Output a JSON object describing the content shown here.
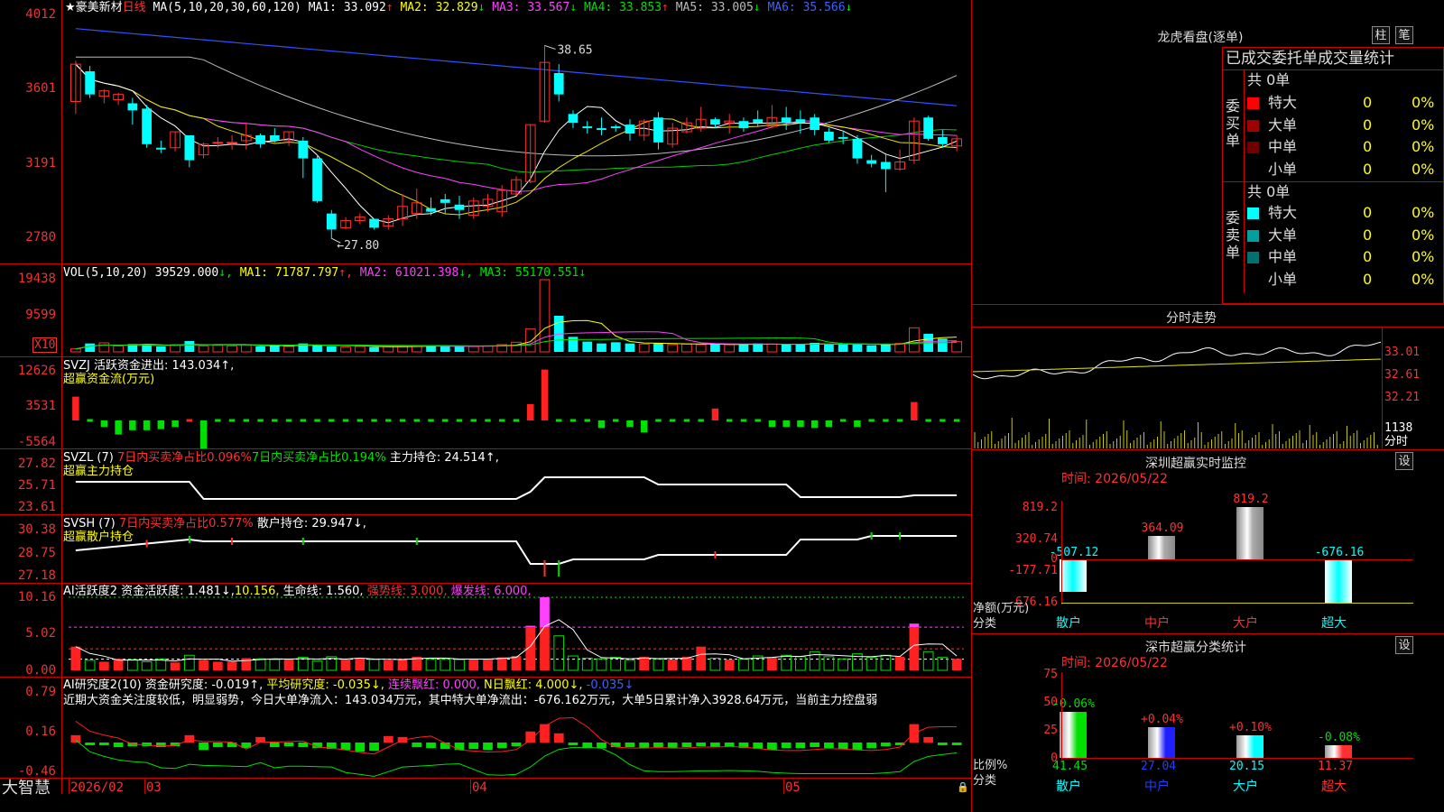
{
  "kline": {
    "header_name": "★豪美新材",
    "header_period": "日线",
    "ma_label": "MA(5,10,20,30,60,120)",
    "ma_items": [
      {
        "text": "MA1: 33.092",
        "arrow": "↑",
        "color": "#ffffff"
      },
      {
        "text": "MA2: 32.829",
        "arrow": "↓",
        "color": "#ffff00"
      },
      {
        "text": "MA3: 33.567",
        "arrow": "↓",
        "color": "#ff40ff"
      },
      {
        "text": "MA4: 33.853",
        "arrow": "↑",
        "color": "#00e000"
      },
      {
        "text": "MA5: 33.005",
        "arrow": "↓",
        "color": "#bbbbbb"
      },
      {
        "text": "MA6: 35.566",
        "arrow": "↓",
        "color": "#4060ff"
      }
    ],
    "axis": [
      "4012",
      "3601",
      "3191",
      "2780"
    ],
    "high_label": "38.65",
    "low_label": "27.80"
  },
  "vol": {
    "label": "VOL(5,10,20)",
    "v": "39529.000",
    "ma1": "MA1: 71787.797",
    "ma2": "MA2: 61021.398",
    "ma3": "MA3: 55170.551",
    "axis": [
      "19438",
      "9599"
    ],
    "x10": "X10"
  },
  "svzj": {
    "line1": "SVZJ  活跃资金进出: 143.034↑,",
    "line2": "超赢资金流(万元)",
    "axis": [
      "12626",
      "3531",
      "-5564"
    ]
  },
  "svzl": {
    "prefix": "SVZL (7)",
    "a": "7日内买卖净占比0.096%",
    "b": "7日内买卖净占比0.194%",
    "c": "主力持仓: 24.514↑,",
    "line2": "超赢主力持仓",
    "axis": [
      "27.82",
      "25.71",
      "23.61"
    ]
  },
  "svsh": {
    "prefix": "SVSH (7)",
    "a": "7日内买卖净占比0.577%",
    "c": "散户持仓: 29.947↓,",
    "line2": "超赢散户持仓",
    "axis": [
      "30.38",
      "28.75",
      "27.18"
    ]
  },
  "ai1": {
    "prefix": "AI活跃度2",
    "a": "资金活跃度: 1.481↓,",
    "b": "10.156,",
    "c": "生命线: 1.560,",
    "d": "强势线: 3.000,",
    "e": "爆发线: 6.000,",
    "axis": [
      "10.16",
      "5.02",
      "0.00"
    ]
  },
  "ai2": {
    "prefix": "AI研究度2(10)",
    "a": "资金研究度: -0.019↑,",
    "b": "平均研究度: -0.035↓,",
    "c": "连续飘红: 0.000,",
    "d": "N日飘红: 4.000↓,",
    "e": "-0.035↓",
    "comment": "近期大资金关注度较低，明显弱势，今日大单净流入：143.034万元，其中特大单净流出：-676.162万元，大单5日累计净入3928.64万元，当前主力控盘弱",
    "axis": [
      "0.79",
      "0.16",
      "-0.46"
    ]
  },
  "bottom": {
    "brand": "大智慧",
    "dates": [
      "2026/02",
      "03",
      "04",
      "05"
    ]
  },
  "dragon": {
    "title": "龙虎看盘(逐单)",
    "btn1": "柱",
    "btn2": "笔",
    "subtitle": "已成交委托单成交量统计",
    "buy_label": "委买单",
    "sell_label": "委卖单",
    "buy_total": "共 0单",
    "sell_total": "共 0单",
    "buy_rows": [
      {
        "name": "特大",
        "count": "0",
        "pct": "0%",
        "color": "#ff0000"
      },
      {
        "name": "大单",
        "count": "0",
        "pct": "0%",
        "color": "#a00000"
      },
      {
        "name": "中单",
        "count": "0",
        "pct": "0%",
        "color": "#700000"
      },
      {
        "name": "小单",
        "count": "0",
        "pct": "0%",
        "color": "#000000"
      }
    ],
    "sell_rows": [
      {
        "name": "特大",
        "count": "0",
        "pct": "0%",
        "color": "#00ffff"
      },
      {
        "name": "大单",
        "count": "0",
        "pct": "0%",
        "color": "#00a0a0"
      },
      {
        "name": "中单",
        "count": "0",
        "pct": "0%",
        "color": "#007070"
      },
      {
        "name": "小单",
        "count": "0",
        "pct": "0%",
        "color": "#000000"
      }
    ]
  },
  "intraday": {
    "title": "分时走势",
    "axis": [
      "33.01",
      "32.61",
      "32.21",
      "1138"
    ],
    "bottom_label": "分时"
  },
  "monitor": {
    "title": "深圳超赢实时监控",
    "btn": "设",
    "time": "时间: 2026/05/22",
    "axis": [
      "819.2",
      "320.74",
      "0",
      "-177.71",
      "-676.16"
    ],
    "ylabel1": "净额(万元)",
    "ylabel2": "分类",
    "bars": [
      {
        "name": "散户",
        "value": -507.12,
        "label": "-507.12"
      },
      {
        "name": "中户",
        "value": 364.09,
        "label": "364.09"
      },
      {
        "name": "大户",
        "value": 819.2,
        "label": "819.2"
      },
      {
        "name": "超大",
        "value": -676.16,
        "label": "-676.16"
      }
    ]
  },
  "classify": {
    "title": "深市超赢分类统计",
    "btn": "设",
    "time": "时间: 2026/05/22",
    "axis": [
      "75",
      "50",
      "25",
      "0"
    ],
    "ylabel1": "比例%",
    "ylabel2": "分类",
    "bars": [
      {
        "name": "散户",
        "value": 41.45,
        "label": "41.45",
        "delta": "-0.06%",
        "color": "#00e000"
      },
      {
        "name": "中户",
        "value": 27.04,
        "label": "27.04",
        "delta": "+0.04%",
        "color": "#2020ff"
      },
      {
        "name": "大户",
        "value": 20.15,
        "label": "20.15",
        "delta": "+0.10%",
        "color": "#00ffff"
      },
      {
        "name": "超大",
        "value": 11.37,
        "label": "11.37",
        "delta": "-0.08%",
        "color": "#ff3030"
      }
    ]
  },
  "chart_data": {
    "type": "candlestick",
    "ylim": [
      27.0,
      40.5
    ],
    "candles": [
      [
        35.5,
        37.6,
        34.8,
        37.8
      ],
      [
        37.2,
        35.9,
        35.7,
        37.5
      ],
      [
        35.8,
        36.1,
        35.4,
        36.2
      ],
      [
        35.6,
        35.9,
        35.3,
        36.0
      ],
      [
        35.4,
        35.0,
        34.2,
        35.7
      ],
      [
        35.1,
        33.1,
        32.9,
        35.3
      ],
      [
        32.9,
        32.8,
        32.6,
        33.3
      ],
      [
        32.9,
        33.8,
        32.7,
        33.8
      ],
      [
        33.6,
        32.2,
        31.8,
        33.6
      ],
      [
        32.5,
        33.1,
        32.3,
        33.2
      ],
      [
        33.2,
        33.2,
        32.9,
        33.5
      ],
      [
        33.2,
        33.2,
        32.8,
        33.6
      ],
      [
        33.3,
        33.6,
        32.8,
        34.3
      ],
      [
        33.6,
        33.1,
        32.9,
        33.7
      ],
      [
        33.6,
        33.3,
        33.2,
        34.0
      ],
      [
        33.3,
        33.8,
        33.0,
        33.8
      ],
      [
        33.3,
        32.3,
        31.2,
        33.5
      ],
      [
        32.3,
        29.9,
        29.8,
        32.5
      ],
      [
        29.2,
        28.3,
        27.8,
        29.4
      ],
      [
        28.4,
        28.8,
        28.3,
        29.0
      ],
      [
        28.8,
        29.0,
        28.6,
        29.2
      ],
      [
        28.9,
        28.4,
        28.3,
        28.9
      ],
      [
        28.5,
        28.9,
        28.3,
        29.1
      ],
      [
        28.9,
        29.6,
        28.5,
        30.3
      ],
      [
        29.2,
        29.8,
        28.9,
        30.6
      ],
      [
        29.5,
        29.3,
        29.1,
        30.1
      ],
      [
        30.0,
        29.8,
        29.2,
        30.3
      ],
      [
        29.7,
        29.4,
        28.9,
        30.2
      ],
      [
        29.1,
        29.9,
        28.9,
        30.1
      ],
      [
        29.6,
        30.0,
        29.3,
        30.3
      ],
      [
        29.3,
        30.5,
        29.0,
        30.8
      ],
      [
        30.3,
        31.1,
        30.2,
        31.3
      ],
      [
        31.0,
        34.2,
        30.9,
        34.2
      ],
      [
        34.4,
        37.7,
        34.3,
        38.65
      ],
      [
        37.1,
        35.9,
        35.5,
        37.6
      ],
      [
        34.8,
        34.3,
        34.0,
        35.0
      ],
      [
        34.1,
        34.0,
        33.7,
        34.4
      ],
      [
        34.0,
        33.9,
        33.6,
        34.6
      ],
      [
        34.1,
        34.0,
        33.8,
        34.2
      ],
      [
        34.2,
        33.7,
        33.3,
        34.5
      ],
      [
        33.6,
        34.4,
        33.3,
        34.5
      ],
      [
        34.6,
        33.2,
        32.8,
        34.9
      ],
      [
        33.1,
        34.0,
        32.9,
        34.3
      ],
      [
        33.8,
        34.3,
        33.7,
        34.6
      ],
      [
        34.0,
        34.5,
        33.8,
        35.2
      ],
      [
        34.5,
        34.2,
        34.0,
        34.6
      ],
      [
        34.3,
        34.4,
        33.7,
        34.8
      ],
      [
        34.4,
        34.0,
        33.8,
        34.6
      ],
      [
        34.5,
        34.3,
        34.1,
        35.0
      ],
      [
        34.1,
        34.6,
        34.1,
        35.3
      ],
      [
        34.6,
        34.3,
        33.9,
        35.2
      ],
      [
        34.5,
        34.3,
        33.7,
        35.0
      ],
      [
        34.6,
        33.9,
        33.6,
        34.8
      ],
      [
        33.8,
        33.3,
        33.2,
        34.0
      ],
      [
        33.5,
        33.4,
        33.1,
        33.8
      ],
      [
        33.4,
        32.3,
        32.0,
        33.6
      ],
      [
        32.2,
        32.0,
        31.8,
        32.5
      ],
      [
        32.1,
        31.7,
        30.4,
        32.6
      ],
      [
        31.7,
        32.1,
        31.6,
        32.8
      ],
      [
        32.2,
        34.4,
        32.0,
        34.6
      ],
      [
        34.6,
        33.4,
        33.3,
        34.7
      ],
      [
        33.5,
        33.1,
        32.9,
        33.9
      ],
      [
        33.0,
        33.4,
        32.7,
        33.6
      ]
    ],
    "volume": [
      5,
      14,
      15,
      10,
      13,
      11,
      9,
      12,
      18,
      10,
      11,
      10,
      12,
      9,
      11,
      9,
      14,
      12,
      9,
      8,
      9,
      8,
      9,
      9,
      10,
      11,
      10,
      9,
      9,
      10,
      12,
      16,
      38,
      120,
      60,
      25,
      17,
      14,
      16,
      14,
      13,
      15,
      12,
      13,
      12,
      13,
      12,
      12,
      14,
      13,
      12,
      13,
      15,
      12,
      12,
      14,
      11,
      12,
      14,
      40,
      30,
      22,
      17
    ],
    "svzj": [
      2.2,
      -0.5,
      -0.6,
      -1.3,
      -0.9,
      -0.9,
      -0.8,
      -0.6,
      0.4,
      -2.6,
      -0.2,
      -0.4,
      -0.3,
      -0.3,
      -0.4,
      -0.3,
      -0.4,
      -0.5,
      -0.5,
      -0.4,
      -0.4,
      -0.2,
      -0.3,
      -0.3,
      -0.4,
      -0.3,
      -0.3,
      -0.4,
      -0.5,
      -0.4,
      -0.3,
      -0.3,
      1.5,
      4.7,
      -0.2,
      -0.4,
      -0.5,
      -0.7,
      -0.5,
      -0.6,
      -1.1,
      -0.5,
      -0.3,
      -0.5,
      -0.5,
      1.1,
      -0.3,
      -0.5,
      -0.5,
      -0.6,
      -0.6,
      -0.6,
      -0.7,
      -0.6,
      -0.5,
      -0.6,
      -0.4,
      -0.5,
      -0.4,
      1.7,
      -0.4,
      -0.2,
      -0.3
    ],
    "ai1": [
      3.3,
      1.4,
      1.2,
      1.6,
      1.5,
      1.2,
      1.6,
      1.1,
      2.1,
      1.4,
      1.2,
      1.2,
      1.7,
      1.6,
      1.5,
      1.6,
      1.8,
      1.3,
      1.9,
      1.5,
      1.7,
      1.5,
      1.4,
      1.6,
      1.9,
      1.6,
      1.6,
      1.5,
      1.6,
      1.6,
      1.8,
      2.0,
      6.2,
      10.16,
      4.8,
      2.0,
      1.7,
      1.6,
      1.8,
      1.4,
      1.9,
      1.6,
      1.5,
      1.9,
      3.3,
      1.7,
      1.5,
      1.6,
      2.0,
      1.8,
      2.1,
      1.9,
      2.6,
      1.9,
      1.6,
      2.3,
      1.8,
      2.1,
      1.9,
      6.5,
      2.6,
      1.8,
      1.6
    ],
    "ai2": [
      0.08,
      -0.02,
      -0.03,
      -0.05,
      -0.04,
      -0.04,
      -0.05,
      -0.04,
      0.08,
      -0.08,
      -0.05,
      -0.05,
      -0.06,
      0.06,
      -0.05,
      -0.04,
      -0.05,
      -0.06,
      -0.07,
      -0.08,
      -0.1,
      -0.09,
      0.07,
      0.06,
      -0.05,
      -0.06,
      -0.07,
      -0.08,
      -0.07,
      -0.08,
      -0.06,
      -0.04,
      0.12,
      0.2,
      0.1,
      -0.03,
      -0.06,
      -0.06,
      -0.05,
      -0.05,
      -0.06,
      -0.05,
      -0.06,
      -0.05,
      -0.04,
      -0.05,
      -0.05,
      -0.06,
      -0.07,
      -0.08,
      -0.06,
      -0.06,
      -0.05,
      -0.06,
      -0.07,
      -0.08,
      -0.06,
      -0.04,
      -0.02,
      0.2,
      0.06,
      -0.03,
      -0.02
    ]
  }
}
